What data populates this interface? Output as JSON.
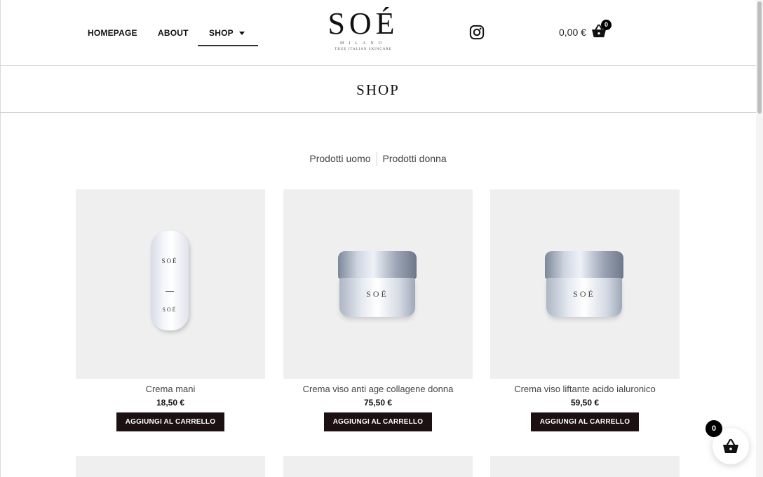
{
  "header": {
    "nav": [
      {
        "label": "HOMEPAGE"
      },
      {
        "label": "ABOUT"
      },
      {
        "label": "SHOP"
      }
    ],
    "logo": {
      "main": "SOÉ",
      "sub": "MILANO",
      "tagline": "TRUE ITALIAN SKINCARE"
    },
    "social_icon": "instagram-icon",
    "cart": {
      "total": "0,00 €",
      "count": "0",
      "icon": "basket-icon"
    }
  },
  "page": {
    "title": "SHOP"
  },
  "filters": [
    {
      "label": "Prodotti uomo"
    },
    {
      "label": "Prodotti donna"
    }
  ],
  "products": [
    {
      "name": "Crema mani",
      "price": "18,50 €",
      "button": "AGGIUNGI AL CARRELLO",
      "label_top": "SOÉ",
      "label_bottom": "SOÉ"
    },
    {
      "name": "Crema viso anti age collagene donna",
      "price": "75,50 €",
      "button": "AGGIUNGI AL CARRELLO",
      "label": "SOÉ"
    },
    {
      "name": "Crema viso liftante acido ialuronico",
      "price": "59,50 €",
      "button": "AGGIUNGI AL CARRELLO",
      "label": "SOÉ"
    }
  ],
  "floating_cart": {
    "count": "0",
    "icon": "basket-icon"
  },
  "colors": {
    "button_bg": "#1c1012",
    "card_bg": "#efefef",
    "badge": "#000000"
  }
}
